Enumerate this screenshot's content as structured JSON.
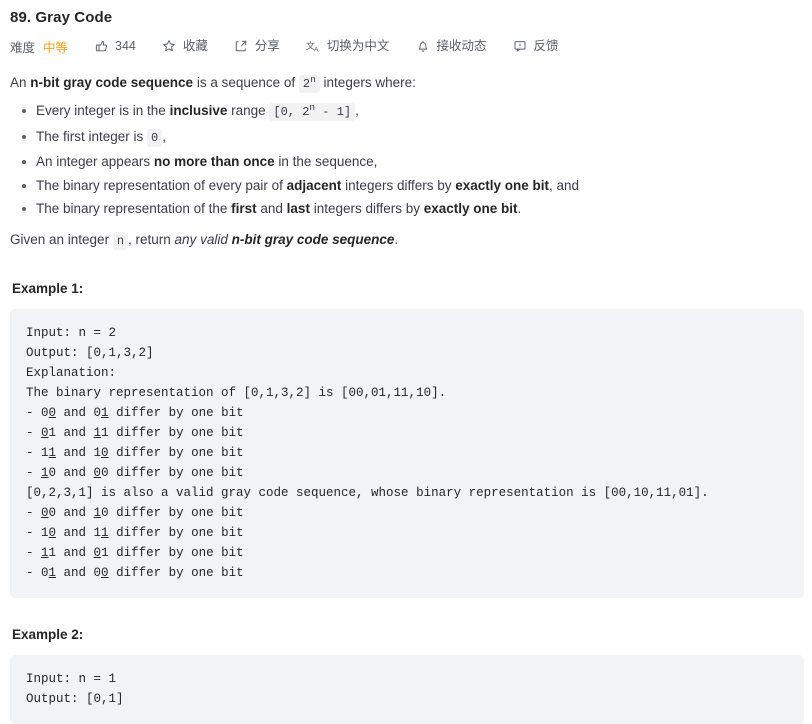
{
  "problem": {
    "title": "89. Gray Code"
  },
  "toolbar": {
    "difficulty_label": "难度",
    "difficulty_value": "中等",
    "difficulty_color": "#ffa116",
    "items": [
      {
        "icon": "thumbs-up-icon",
        "label": "344",
        "name": "like-button"
      },
      {
        "icon": "star-icon",
        "label": "收藏",
        "name": "favorite-button"
      },
      {
        "icon": "share-icon",
        "label": "分享",
        "name": "share-button"
      },
      {
        "icon": "translate-icon",
        "label": "切换为中文",
        "name": "switch-language-button"
      },
      {
        "icon": "bell-icon",
        "label": "接收动态",
        "name": "subscribe-button"
      },
      {
        "icon": "feedback-icon",
        "label": "反馈",
        "name": "feedback-button"
      }
    ]
  },
  "description": {
    "intro": {
      "t1": "An ",
      "b1": "n-bit gray code sequence",
      "t2": " is a sequence of ",
      "code1": "2",
      "code1_sup": "n",
      "t3": " integers where:"
    },
    "rules": [
      {
        "t1": "Every integer is in the ",
        "b1": "inclusive",
        "t2": " range ",
        "code_pre": "[0, 2",
        "code_sup": "n",
        "code_post": " - 1]",
        "t3": ","
      },
      {
        "t1": "The first integer is ",
        "code": "0",
        "t2": ","
      },
      {
        "t1": "An integer appears ",
        "b1": "no more than once",
        "t2": " in the sequence,"
      },
      {
        "t1": "The binary representation of every pair of ",
        "b1": "adjacent",
        "t2": " integers differs by ",
        "b2": "exactly one bit",
        "t3": ", and"
      },
      {
        "t1": "The binary representation of the ",
        "b1": "first",
        "t2": " and ",
        "b2": "last",
        "t3": " integers differs by ",
        "b3": "exactly one bit",
        "t4": "."
      }
    ],
    "given": {
      "t1": "Given an integer ",
      "code": "n",
      "t2": ", return ",
      "em": "any valid ",
      "bi": "n-bit gray code sequence",
      "t3": "."
    }
  },
  "examples": [
    {
      "heading": "Example 1:",
      "lines": [
        {
          "text": "Input: n = 2"
        },
        {
          "text": "Output: [0,1,3,2]"
        },
        {
          "text": "Explanation:"
        },
        {
          "text": "The binary representation of [0,1,3,2] is [00,01,11,10]."
        },
        {
          "prefix": "- 0",
          "u1": "0",
          "mid": " and 0",
          "u2": "1",
          "suffix": " differ by one bit"
        },
        {
          "prefix": "- ",
          "u1": "0",
          "mid": "1 and ",
          "u2": "1",
          "suffix": "1 differ by one bit"
        },
        {
          "prefix": "- 1",
          "u1": "1",
          "mid": " and 1",
          "u2": "0",
          "suffix": " differ by one bit"
        },
        {
          "prefix": "- ",
          "u1": "1",
          "mid": "0 and ",
          "u2": "0",
          "suffix": "0 differ by one bit"
        },
        {
          "text": "[0,2,3,1] is also a valid gray code sequence, whose binary representation is [00,10,11,01]."
        },
        {
          "prefix": "- ",
          "u1": "0",
          "mid": "0 and ",
          "u2": "1",
          "suffix": "0 differ by one bit"
        },
        {
          "prefix": "- 1",
          "u1": "0",
          "mid": " and 1",
          "u2": "1",
          "suffix": " differ by one bit"
        },
        {
          "prefix": "- ",
          "u1": "1",
          "mid": "1 and ",
          "u2": "0",
          "suffix": "1 differ by one bit"
        },
        {
          "prefix": "- 0",
          "u1": "1",
          "mid": " and 0",
          "u2": "0",
          "suffix": " differ by one bit"
        }
      ]
    },
    {
      "heading": "Example 2:",
      "lines": [
        {
          "text": "Input: n = 1"
        },
        {
          "text": "Output: [0,1]"
        }
      ]
    }
  ]
}
